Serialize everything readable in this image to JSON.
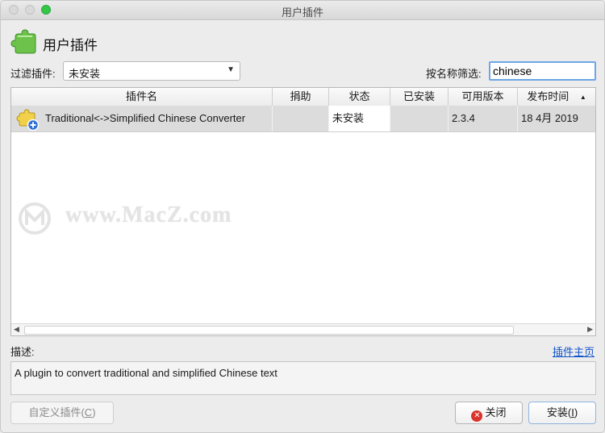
{
  "window": {
    "title": "用户插件"
  },
  "header": {
    "title": "用户插件",
    "icon": "puzzle-piece-icon"
  },
  "filter": {
    "label": "过滤插件:",
    "selected": "未安装",
    "name_label": "按名称筛选:",
    "name_value": "chinese"
  },
  "table": {
    "columns": [
      "插件名",
      "捐助",
      "状态",
      "已安装",
      "可用版本",
      "发布时间"
    ],
    "sort_indicator": "▲",
    "rows": [
      {
        "icon": "plugin-add-icon",
        "name": "Traditional<->Simplified Chinese Converter",
        "donate": "",
        "status": "未安装",
        "installed": "",
        "available_version": "2.3.4",
        "release_date": "18 4月 2019"
      }
    ]
  },
  "watermark": {
    "text": "www.MacZ.com"
  },
  "description": {
    "label": "描述:",
    "homepage_link": "插件主页",
    "text": "A plugin to convert traditional and simplified Chinese text"
  },
  "buttons": {
    "custom_main": "自定义插件(",
    "custom_key": "C",
    "custom_end": ")",
    "close": "关闭",
    "install_main": "安装(",
    "install_key": "I",
    "install_end": ")"
  },
  "colors": {
    "accent_link": "#1155cc",
    "focus_ring": "#6da6e6",
    "close_badge": "#d9342b"
  }
}
